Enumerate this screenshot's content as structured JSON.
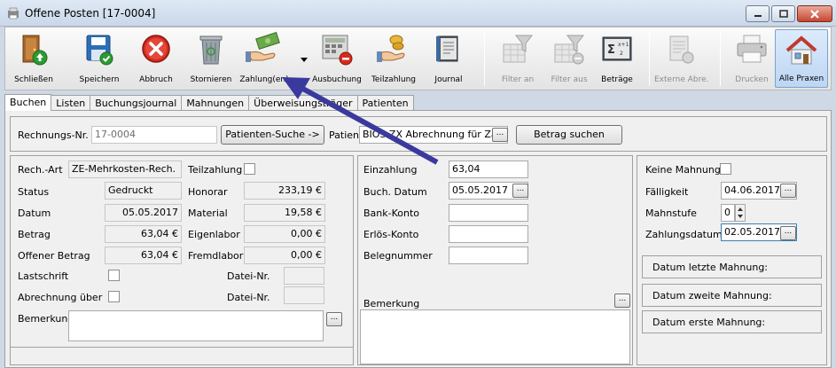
{
  "window": {
    "title": "Offene Posten  [17-0004]"
  },
  "toolbar": {
    "buttons": [
      {
        "label": "Schließen"
      },
      {
        "label": "Speichern"
      },
      {
        "label": "Abbruch"
      },
      {
        "label": "Stornieren"
      },
      {
        "label": "Zahlung(en)"
      },
      {
        "label": "Ausbuchung"
      },
      {
        "label": "Teilzahlung"
      },
      {
        "label": "Journal"
      },
      {
        "label": "Filter an"
      },
      {
        "label": "Filter aus"
      },
      {
        "label": "Beträge"
      },
      {
        "label": "Externe Abre."
      },
      {
        "label": "Drucken"
      },
      {
        "label": "Alle Praxen"
      }
    ]
  },
  "tabs": [
    {
      "label": "Buchen"
    },
    {
      "label": "Listen"
    },
    {
      "label": "Buchungsjournal"
    },
    {
      "label": "Mahnungen"
    },
    {
      "label": "Überweisungsträger"
    },
    {
      "label": "Patienten"
    }
  ],
  "top_row": {
    "rechnungs_nr_label": "Rechnungs-Nr.",
    "rechnungs_nr_value": "17-0004",
    "patienten_suche_label": "Patienten-Suche ->",
    "patient_label": "Patient",
    "patient_value": "BIOS ZX Abrechnung für Za",
    "betrag_suchen_label": "Betrag suchen",
    "ellipsis": "..."
  },
  "left": {
    "rech_art_label": "Rech.-Art",
    "rech_art_value": "ZE-Mehrkosten-Rech.",
    "status_label": "Status",
    "status_value": "Gedruckt",
    "datum_label": "Datum",
    "datum_value": "05.05.2017",
    "betrag_label": "Betrag",
    "betrag_value": "63,04 €",
    "offener_betrag_label": "Offener Betrag",
    "offener_betrag_value": "63,04 €",
    "lastschrift_label": "Lastschrift",
    "abrechnung_ueber_label": "Abrechnung über",
    "bemerkung_label": "Bemerkung",
    "teilzahlung_label": "Teilzahlung",
    "honorar_label": "Honorar",
    "honorar_value": "233,19 €",
    "material_label": "Material",
    "material_value": "19,58 €",
    "eigenlabor_label": "Eigenlabor",
    "eigenlabor_value": "0,00 €",
    "fremdlabor_label": "Fremdlabor",
    "fremdlabor_value": "0,00 €",
    "datei_nr_label_1": "Datei-Nr.",
    "datei_nr_label_2": "Datei-Nr."
  },
  "middle": {
    "einzahlung_label": "Einzahlung",
    "einzahlung_value": "63,04",
    "buch_datum_label": "Buch. Datum",
    "buch_datum_value": "05.05.2017",
    "bank_konto_label": "Bank-Konto",
    "erloes_konto_label": "Erlös-Konto",
    "belegnummer_label": "Belegnummer",
    "bemerkung_label": "Bemerkung"
  },
  "right": {
    "keine_mahnung_label": "Keine Mahnung",
    "faelligkeit_label": "Fälligkeit",
    "faelligkeit_value": "04.06.2017",
    "mahnstufe_label": "Mahnstufe",
    "mahnstufe_value": "0",
    "zahlungsdatum_label": "Zahlungsdatum",
    "zahlungsdatum_value": "02.05.2017",
    "letzte_mahnung_label": "Datum letzte Mahnung:",
    "zweite_mahnung_label": "Datum zweite Mahnung:",
    "erste_mahnung_label": "Datum erste Mahnung:"
  },
  "colors": {
    "annotation_arrow": "#3a3a9e",
    "window_frame": "#cfd9e6",
    "active_tab": "#ffffff"
  }
}
